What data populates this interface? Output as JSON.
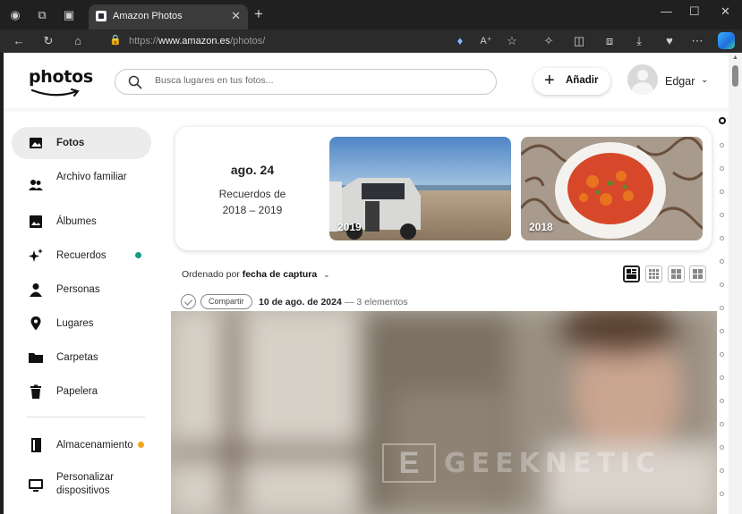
{
  "browser": {
    "tab_title": "Amazon Photos",
    "url_prefix": "https://",
    "url_domain": "www.amazon.es",
    "url_path": "/photos/"
  },
  "header": {
    "logo_text": "photos",
    "search_placeholder": "Busca lugares en tus fotos...",
    "add_label": "Añadir",
    "user_name": "Edgar"
  },
  "sidebar": {
    "items": [
      {
        "label": "Fotos",
        "icon": "photo-icon"
      },
      {
        "label": "Archivo familiar",
        "icon": "people-icon"
      },
      {
        "label": "Álbumes",
        "icon": "album-icon"
      },
      {
        "label": "Recuerdos",
        "icon": "sparkle-icon"
      },
      {
        "label": "Personas",
        "icon": "person-icon"
      },
      {
        "label": "Lugares",
        "icon": "location-pin-icon"
      },
      {
        "label": "Carpetas",
        "icon": "folder-icon"
      },
      {
        "label": "Papelera",
        "icon": "trash-icon"
      },
      {
        "label": "Almacenamiento",
        "icon": "storage-icon"
      },
      {
        "label": "Personalizar dispositivos",
        "icon": "monitor-icon"
      }
    ],
    "recuerdos_dot_color": "#0f9d8a",
    "storage_dot_color": "#f2a31a"
  },
  "memories": {
    "date": "ago. 24",
    "range": "Recuerdos de 2018 – 2019",
    "photos": [
      {
        "year": "2019"
      },
      {
        "year": "2018"
      }
    ]
  },
  "sort": {
    "prefix": "Ordenado por",
    "field": "fecha de captura"
  },
  "group": {
    "share_label": "Compartir",
    "date": "10 de ago. de 2024",
    "count": "— 3 elementos"
  },
  "watermark": {
    "letter": "E",
    "text": "GEEKNETIC"
  }
}
